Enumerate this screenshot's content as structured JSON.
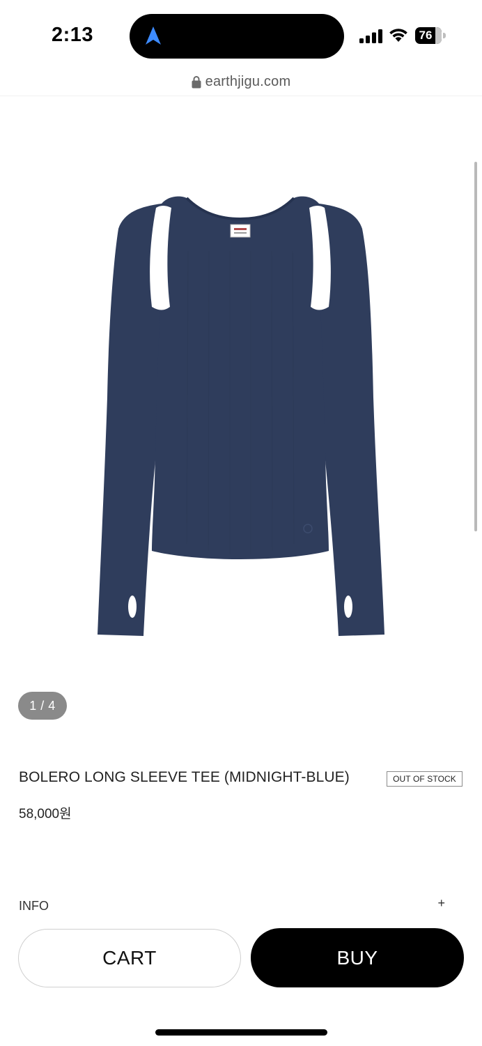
{
  "status_bar": {
    "time": "2:13",
    "battery": "76",
    "icons": [
      "location-arrow-icon",
      "cellular-signal-icon",
      "wifi-icon",
      "battery-icon"
    ]
  },
  "url_bar": {
    "url": "earthjigu.com",
    "icon": "lock-icon"
  },
  "product": {
    "image_counter": "1 / 4",
    "image_color": "#2f3d5c",
    "title": "BOLERO LONG SLEEVE TEE (MIDNIGHT-BLUE)",
    "stock_badge": "OUT OF STOCK",
    "price": "58,000원"
  },
  "info": {
    "label": "INFO",
    "toggle": "+"
  },
  "actions": {
    "cart_label": "CART",
    "buy_label": "BUY"
  },
  "colors": {
    "accent": "#000000",
    "location_arrow": "#3d8bff"
  }
}
